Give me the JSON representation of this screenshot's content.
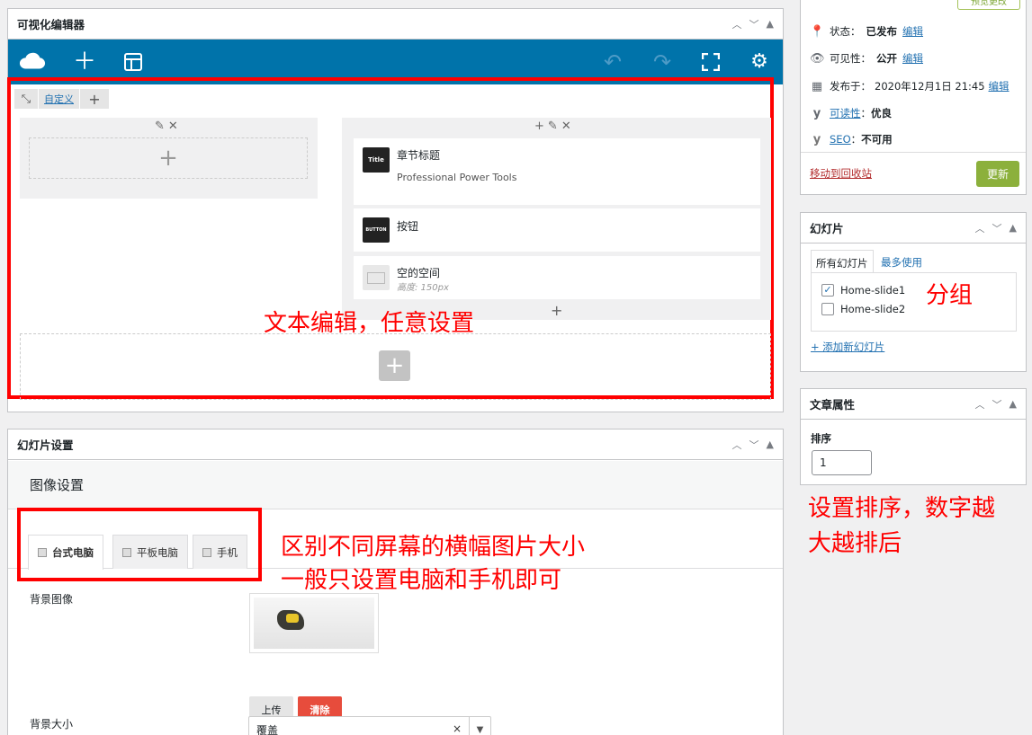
{
  "visual_editor": {
    "title": "可视化编辑器",
    "row_tools_left": [
      "自定义"
    ],
    "widgets": [
      {
        "name": "章节标题",
        "subtitle": "Professional Power Tools",
        "thumb": "Title"
      },
      {
        "name": "按钮",
        "subtitle": "",
        "thumb": "BUTTON"
      },
      {
        "name": "空的空间",
        "subtitle": "高度: 150px",
        "thumb": ""
      }
    ]
  },
  "annotations": {
    "text_edit": "文本编辑，任意设置",
    "group": "分组",
    "sort_line1": "设置排序，数字越",
    "sort_line2": "大越排后",
    "screens_line1": "区别不同屏幕的横幅图片大小",
    "screens_line2": "一般只设置电脑和手机即可"
  },
  "slide_settings": {
    "title": "幻灯片设置",
    "section_title": "图像设置",
    "tabs": [
      "台式电脑",
      "平板电脑",
      "手机"
    ],
    "active_tab": 0,
    "bg_image_label": "背景图像",
    "upload_label": "上传",
    "clear_label": "清除",
    "bg_size_label": "背景大小",
    "bg_size_value": "覆盖",
    "clear_x": "×"
  },
  "publish": {
    "preview_label": "预览更改",
    "status_label": "状态：",
    "status_value": "已发布",
    "visibility_label": "可见性：",
    "visibility_value": "公开",
    "published_label": "发布于：",
    "published_value": "2020年12月1日 21:45",
    "edit_label": "编辑",
    "readability_label": "可读性",
    "readability_value": "优良",
    "seo_label": "SEO",
    "seo_value": "不可用",
    "trash_label": "移动到回收站",
    "update_label": "更新"
  },
  "slides_box": {
    "title": "幻灯片",
    "tabs": [
      "所有幻灯片",
      "最多使用"
    ],
    "items": [
      {
        "label": "Home-slide1",
        "checked": true
      },
      {
        "label": "Home-slide2",
        "checked": false
      }
    ],
    "add_label": "+ 添加新幻灯片"
  },
  "attributes_box": {
    "title": "文章属性",
    "order_label": "排序",
    "order_value": "1"
  },
  "colors": {
    "toolbar": "#0073aa",
    "annotation": "#ff0000",
    "update_button": "#8cb03c",
    "clear_button": "#e74c3c"
  }
}
